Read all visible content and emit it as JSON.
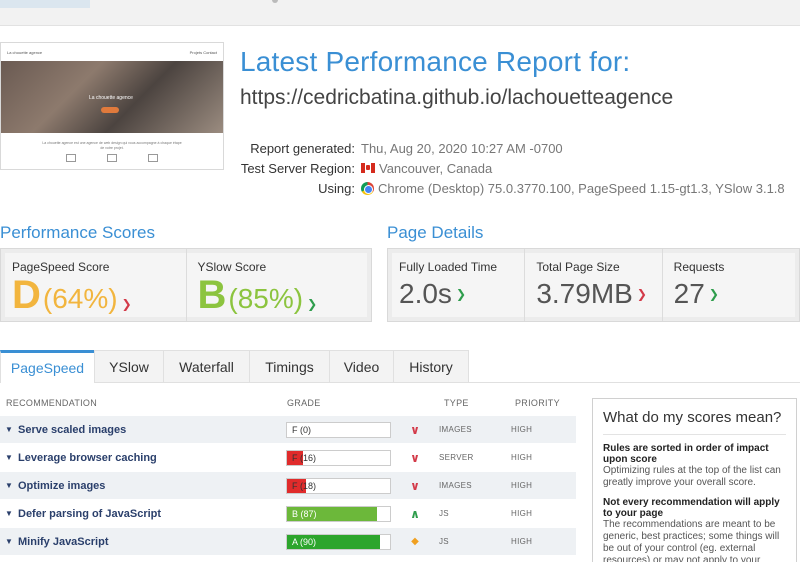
{
  "header": {
    "title": "Latest Performance Report for:",
    "url": "https://cedricbatina.github.io/lachouetteagence"
  },
  "thumbnail": {
    "site_name": "La chouette agence",
    "nav_links": "Projets   Contact",
    "hero_text": "La chouette agence",
    "blurb": "La chouette agence est une agence de web design qui vous accompagne à chaque étape de votre projet."
  },
  "meta": {
    "report_generated_label": "Report generated:",
    "report_generated_value": "Thu, Aug 20, 2020 10:27 AM -0700",
    "region_label": "Test Server Region:",
    "region_value": "Vancouver, Canada",
    "using_label": "Using:",
    "using_value": "Chrome (Desktop) 75.0.3770.100, PageSpeed 1.15-gt1.3, YSlow 3.1.8"
  },
  "performance": {
    "title": "Performance Scores",
    "pagespeed": {
      "label": "PageSpeed Score",
      "grade": "D",
      "percent": "(64%)",
      "trend": "down"
    },
    "yslow": {
      "label": "YSlow Score",
      "grade": "B",
      "percent": "(85%)",
      "trend": "up"
    }
  },
  "details": {
    "title": "Page Details",
    "load_time": {
      "label": "Fully Loaded Time",
      "value": "2.0s",
      "trend": "up"
    },
    "page_size": {
      "label": "Total Page Size",
      "value": "3.79MB",
      "trend": "down"
    },
    "requests": {
      "label": "Requests",
      "value": "27",
      "trend": "up"
    }
  },
  "tabs": [
    {
      "label": "PageSpeed"
    },
    {
      "label": "YSlow"
    },
    {
      "label": "Waterfall"
    },
    {
      "label": "Timings"
    },
    {
      "label": "Video"
    },
    {
      "label": "History"
    }
  ],
  "table": {
    "headers": {
      "recommendation": "RECOMMENDATION",
      "grade": "GRADE",
      "type": "TYPE",
      "priority": "PRIORITY"
    },
    "rows": [
      {
        "name": "Serve scaled images",
        "grade": "F (0)",
        "score": 0,
        "type": "IMAGES",
        "priority": "HIGH",
        "indicator": "down",
        "bar_color": "#e02b2b"
      },
      {
        "name": "Leverage browser caching",
        "grade": "F (16)",
        "score": 16,
        "type": "SERVER",
        "priority": "HIGH",
        "indicator": "down",
        "bar_color": "#e02b2b"
      },
      {
        "name": "Optimize images",
        "grade": "F (18)",
        "score": 18,
        "type": "IMAGES",
        "priority": "HIGH",
        "indicator": "down",
        "bar_color": "#e02b2b"
      },
      {
        "name": "Defer parsing of JavaScript",
        "grade": "B (87)",
        "score": 87,
        "type": "JS",
        "priority": "HIGH",
        "indicator": "up",
        "bar_color": "#6cb83a"
      },
      {
        "name": "Minify JavaScript",
        "grade": "A (90)",
        "score": 90,
        "type": "JS",
        "priority": "HIGH",
        "indicator": "diamond",
        "bar_color": "#2ca52c"
      }
    ]
  },
  "sidebar": {
    "title": "What do my scores mean?",
    "h1": "Rules are sorted in order of impact upon score",
    "p1": "Optimizing rules at the top of the list can greatly improve your overall score.",
    "h2": "Not every recommendation will apply to your page",
    "p2": "The recommendations are meant to be generic, best practices; some things will be out of your control (eg. external resources) or may not apply to your"
  }
}
